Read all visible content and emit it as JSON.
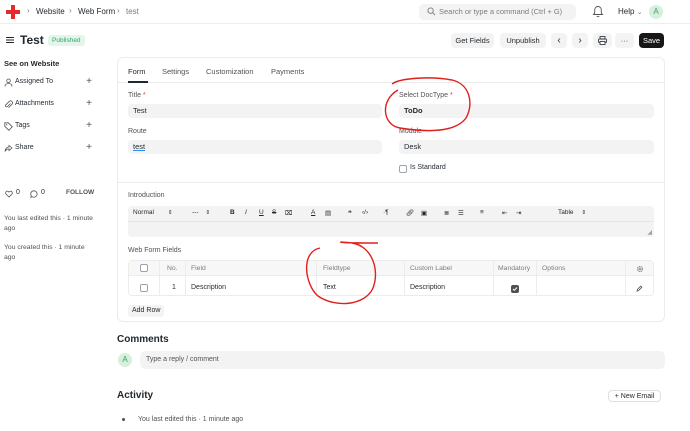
{
  "navbar": {
    "breadcrumbs": [
      "Website",
      "Web Form",
      "test"
    ],
    "search_placeholder": "Search or type a command (Ctrl + G)",
    "help_label": "Help",
    "avatar_letter": "A"
  },
  "header": {
    "title": "Test",
    "status": "Published",
    "get_fields": "Get Fields",
    "unpublish": "Unpublish",
    "prev": "‹",
    "next": "›",
    "print": "⎙",
    "more": "···",
    "save": "Save"
  },
  "sidebar": {
    "see_on_website": "See on Website",
    "items": [
      {
        "label": "Assigned To",
        "icon": "user-icon"
      },
      {
        "label": "Attachments",
        "icon": "paperclip-icon"
      },
      {
        "label": "Tags",
        "icon": "tag-icon"
      },
      {
        "label": "Share",
        "icon": "share-icon"
      }
    ],
    "likes": "0",
    "comments": "0",
    "follow": "FOLLOW",
    "last_edited": "You last edited this · 1 minute ago",
    "created": "You created this · 1 minute ago"
  },
  "tabs": [
    "Form",
    "Settings",
    "Customization",
    "Payments"
  ],
  "form": {
    "title_label": "Title",
    "title_value": "Test",
    "doctype_label": "Select DocType",
    "doctype_value": "ToDo",
    "route_label": "Route",
    "route_value": "test",
    "module_label": "Module",
    "module_value": "Desk",
    "is_standard_label": "Is Standard",
    "introduction_label": "Introduction",
    "web_form_fields_label": "Web Form Fields",
    "add_row": "Add Row"
  },
  "editor_toolbar": {
    "style": "Normal",
    "size": "---",
    "bold": "B",
    "italic": "I",
    "underline": "U",
    "strike": "S",
    "table": "Table"
  },
  "grid": {
    "headers": [
      "No.",
      "Field",
      "Fieldtype",
      "Custom Label",
      "Mandatory",
      "Options"
    ],
    "rows": [
      {
        "no": "1",
        "field": "Description",
        "fieldtype": "Text",
        "custom_label": "Description",
        "mandatory": true,
        "options": ""
      }
    ]
  },
  "comments": {
    "title": "Comments",
    "placeholder": "Type a reply / comment",
    "avatar_letter": "A"
  },
  "activity": {
    "title": "Activity",
    "new_email": "+ New Email",
    "items": [
      "You last edited this · 1 minute ago"
    ]
  },
  "colors": {
    "accent_dark": "#171717",
    "published_green": "#30a66d",
    "annotation_red": "#e0201b",
    "logo_red": "#e42a2a"
  }
}
